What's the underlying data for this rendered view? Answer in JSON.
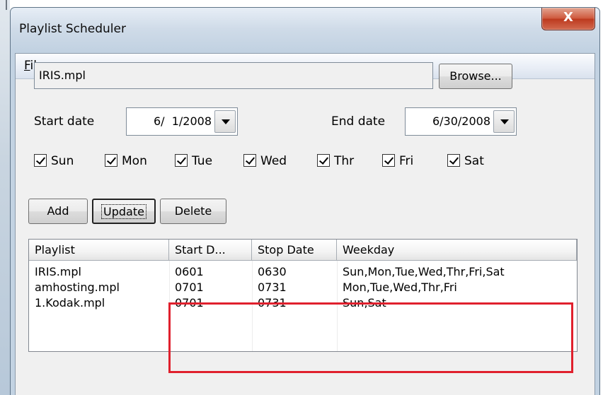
{
  "window": {
    "title": "Playlist Scheduler",
    "close_glyph": "X"
  },
  "menu": {
    "file_mnemonic": "F",
    "file_rest": "ile"
  },
  "file": {
    "value": "IRIS.mpl",
    "browse_label": "Browse..."
  },
  "dates": {
    "start_label": "Start date",
    "start_value": "6/  1/2008",
    "end_label": "End date",
    "end_value": "6/30/2008"
  },
  "days": [
    {
      "label": "Sun",
      "checked": true
    },
    {
      "label": "Mon",
      "checked": true
    },
    {
      "label": "Tue",
      "checked": true
    },
    {
      "label": "Wed",
      "checked": true
    },
    {
      "label": "Thr",
      "checked": true
    },
    {
      "label": "Fri",
      "checked": true
    },
    {
      "label": "Sat",
      "checked": true
    }
  ],
  "actions": {
    "add": "Add",
    "update": "Update",
    "delete": "Delete"
  },
  "list": {
    "columns": [
      "Playlist",
      "Start D...",
      "Stop Date",
      "Weekday"
    ],
    "rows": [
      [
        "IRIS.mpl",
        "0601",
        "0630",
        "Sun,Mon,Tue,Wed,Thr,Fri,Sat"
      ],
      [
        "amhosting.mpl",
        "0701",
        "0731",
        "Mon,Tue,Wed,Thr,Fri"
      ],
      [
        "1.Kodak.mpl",
        "0701",
        "0731",
        "Sun,Sat"
      ]
    ]
  },
  "highlight_color": "#e0202d"
}
